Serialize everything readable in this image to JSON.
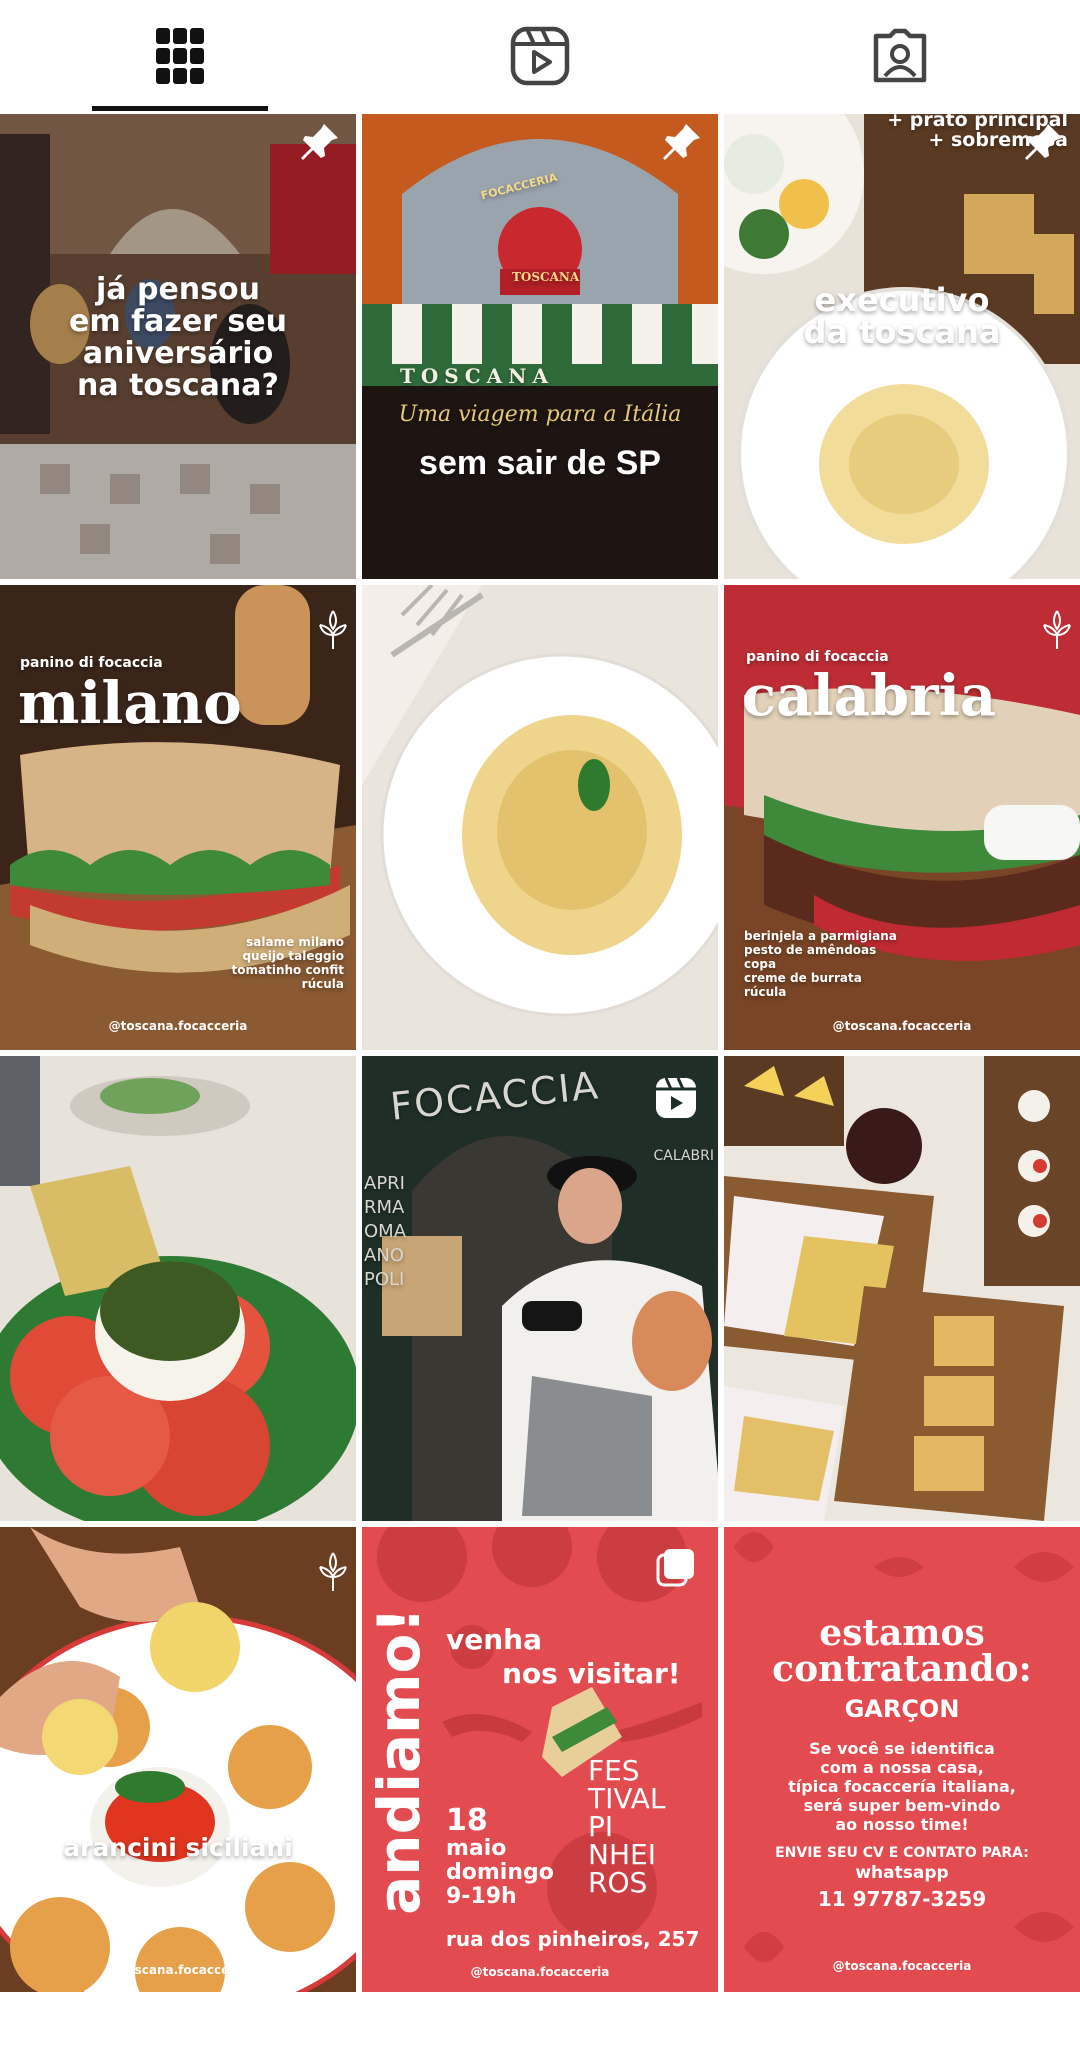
{
  "tabs": [
    {
      "name": "grid",
      "icon": "grid-icon",
      "active": true
    },
    {
      "name": "reels",
      "icon": "reels-icon",
      "active": false
    },
    {
      "name": "tagged",
      "icon": "tagged-user-icon",
      "active": false
    }
  ],
  "posts": {
    "p1": {
      "lines": [
        "já pensou",
        "em fazer seu",
        "aniversário",
        "na toscana?"
      ]
    },
    "p2": {
      "sign_top": "FOCACCERIA",
      "sign_name": "TOSCANA",
      "awning": "TOSCANA",
      "tagline": "Uma viagem para a Itália",
      "headline": "sem sair de SP"
    },
    "p3": {
      "top_line1": "+ prato principal",
      "top_line2": "+ sobremesa",
      "title1": "executivo",
      "title2": "da toscana"
    },
    "p4": {
      "kicker": "panino di focaccia",
      "title": "milano",
      "ingredients": [
        "salame milano",
        "queijo taleggio",
        "tomatinho confit",
        "rúcula"
      ],
      "handle": "@toscana.focacceria"
    },
    "p6": {
      "kicker": "panino di focaccia",
      "title": "calabria",
      "ingredients": [
        "berinjela a parmigiana",
        "pesto de amêndoas",
        "copa",
        "creme de burrata",
        "rúcula"
      ],
      "handle": "@toscana.focacceria"
    },
    "p8": {
      "wall_title": "FOCACCIA",
      "wall_right": "CALABRI",
      "wall_left": [
        "APRI",
        "RMA",
        "OMA",
        "ANO",
        "POLI"
      ]
    },
    "p10": {
      "title": "arancini siciliani",
      "handle": "@toscana.focacceria"
    },
    "p11": {
      "vertical": "andiamo!",
      "line1": "venha",
      "line2": "nos visitar!",
      "date_day": "18",
      "date_month": "maio",
      "date_weekday": "domingo",
      "date_hours": "9-19h",
      "festival": [
        "FES",
        "TIVAL",
        "PI",
        "NHEI",
        "ROS"
      ],
      "address": "rua dos pinheiros, 257",
      "handle": "@toscana.focacceria"
    },
    "p12": {
      "title1": "estamos",
      "title2": "contratando:",
      "role": "GARÇON",
      "body": [
        "Se você se identifica",
        "com a nossa casa,",
        "típica focaccería italiana,",
        "será super bem-vindo",
        "ao nosso time!"
      ],
      "cta": "ENVIE SEU CV E CONTATO PARA:",
      "channel": "whatsapp",
      "phone": "11 97787-3259",
      "handle": "@toscana.focacceria"
    }
  },
  "colors": {
    "brand_red": "#e24b4f",
    "text_dark": "#111111",
    "icon_gray": "#444444"
  }
}
